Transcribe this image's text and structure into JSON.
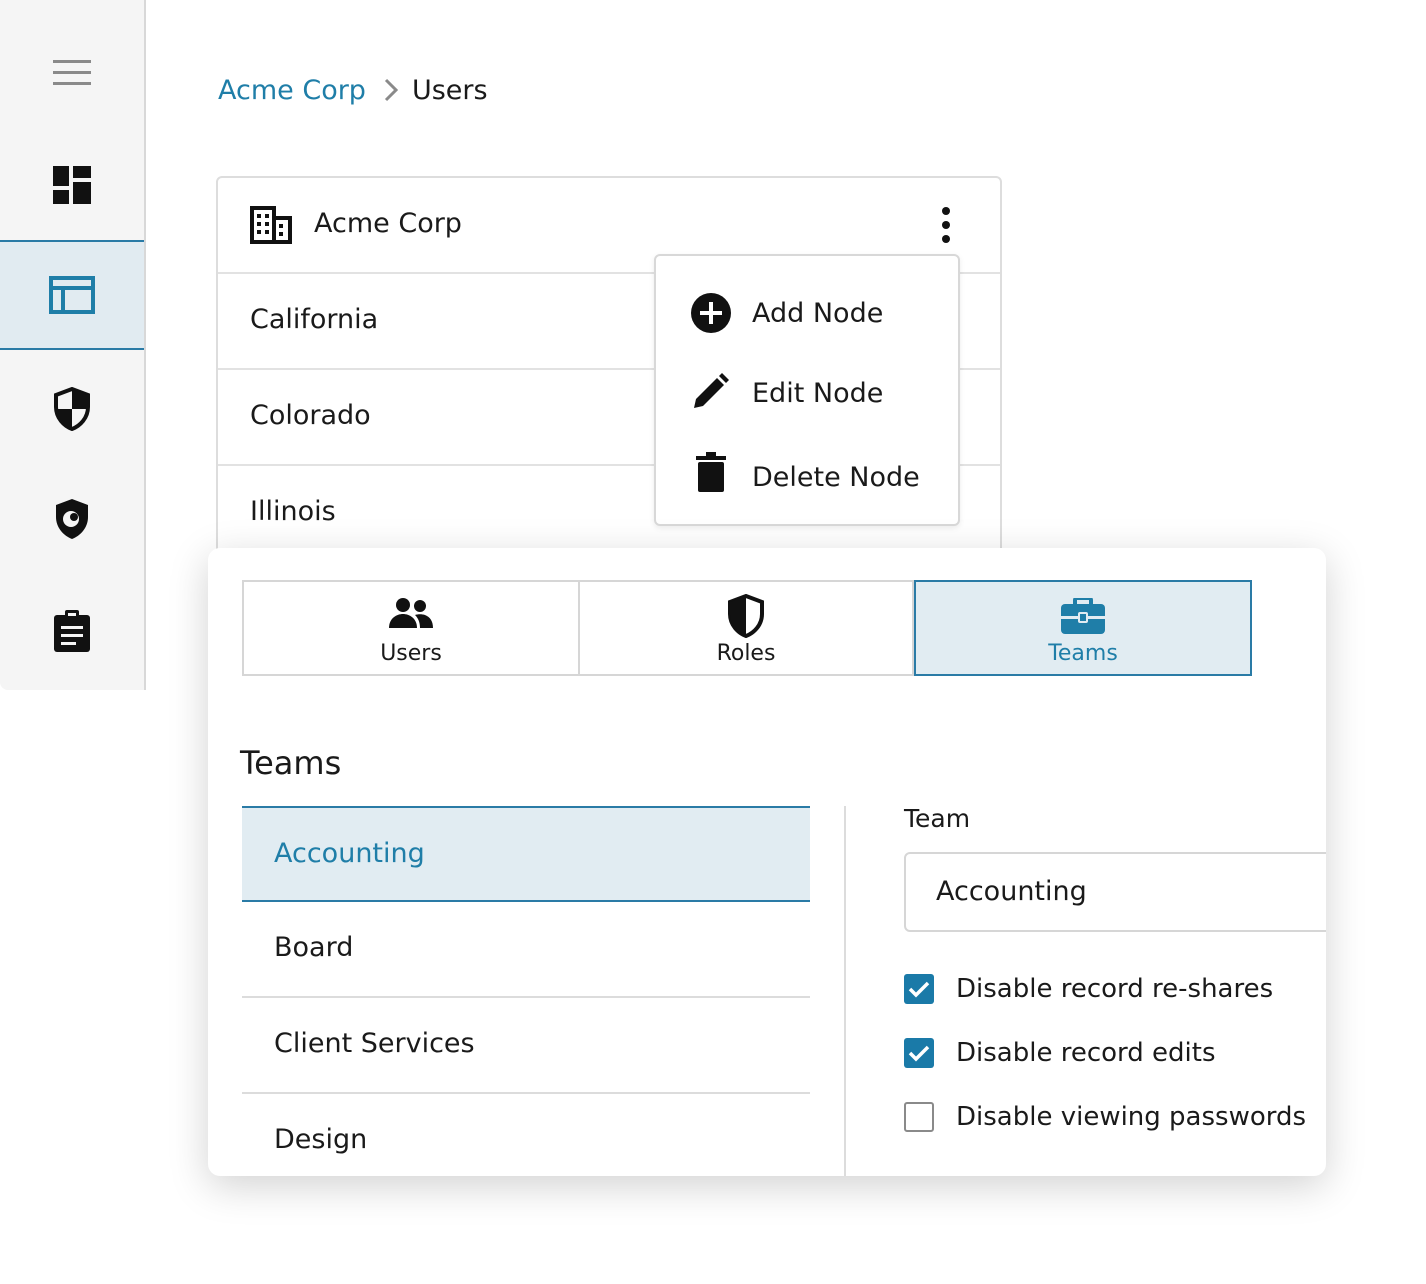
{
  "sidebar": {
    "items": [
      {
        "icon": "hamburger-menu-icon"
      },
      {
        "icon": "dashboard-icon"
      },
      {
        "icon": "admin-panel-icon",
        "active": true
      },
      {
        "icon": "security-shield-icon"
      },
      {
        "icon": "breachwatch-shield-icon"
      },
      {
        "icon": "clipboard-report-icon"
      }
    ]
  },
  "breadcrumb": {
    "parent": "Acme Corp",
    "current": "Users"
  },
  "org_card": {
    "title": "Acme Corp",
    "rows": [
      "California",
      "Colorado",
      "Illinois"
    ]
  },
  "context_menu": {
    "items": [
      {
        "label": "Add Node",
        "icon": "add-circle-icon"
      },
      {
        "label": "Edit Node",
        "icon": "pencil-icon"
      },
      {
        "label": "Delete Node",
        "icon": "trash-icon"
      }
    ]
  },
  "tabs": [
    {
      "label": "Users",
      "icon": "users-icon"
    },
    {
      "label": "Roles",
      "icon": "shield-icon"
    },
    {
      "label": "Teams",
      "icon": "briefcase-icon",
      "active": true
    }
  ],
  "teams": {
    "title": "Teams",
    "list": [
      "Accounting",
      "Board",
      "Client Services",
      "Design"
    ],
    "selected": "Accounting"
  },
  "team_detail": {
    "label": "Team",
    "value": "Accounting",
    "options": [
      {
        "label": "Disable record re-shares",
        "checked": true
      },
      {
        "label": "Disable record edits",
        "checked": true
      },
      {
        "label": "Disable viewing passwords",
        "checked": false
      }
    ]
  },
  "colors": {
    "accent": "#1f7ea8",
    "active_bg": "#e1ecf2",
    "border": "#d6d6d6"
  }
}
